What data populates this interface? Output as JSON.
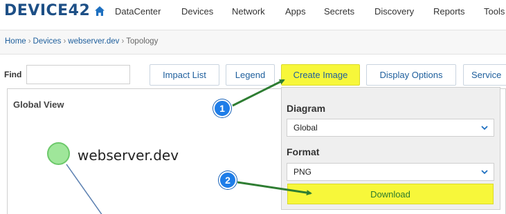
{
  "logo": "DEVICE42",
  "nav": [
    "DataCenter",
    "Devices",
    "Network",
    "Apps",
    "Secrets",
    "Discovery",
    "Reports",
    "Tools"
  ],
  "breadcrumb": {
    "home": "Home",
    "devices": "Devices",
    "device": "webserver.dev",
    "current": "Topology",
    "separator": "›"
  },
  "toolbar": {
    "find_label": "Find",
    "find_value": "",
    "buttons": [
      "Impact List",
      "Legend",
      "Create Image",
      "Display Options",
      "Service"
    ]
  },
  "canvas": {
    "view_title": "Global View",
    "node_label": "webserver.dev"
  },
  "panel": {
    "diagram_label": "Diagram",
    "diagram_value": "Global",
    "format_label": "Format",
    "format_value": "PNG",
    "download_label": "Download"
  },
  "markers": [
    "1",
    "2"
  ],
  "colors": {
    "highlight": "#f7f73a",
    "link": "#1d5e9c",
    "node_fill": "#9fe69a",
    "marker": "#1e7de8",
    "arrow": "#2e7d32"
  }
}
